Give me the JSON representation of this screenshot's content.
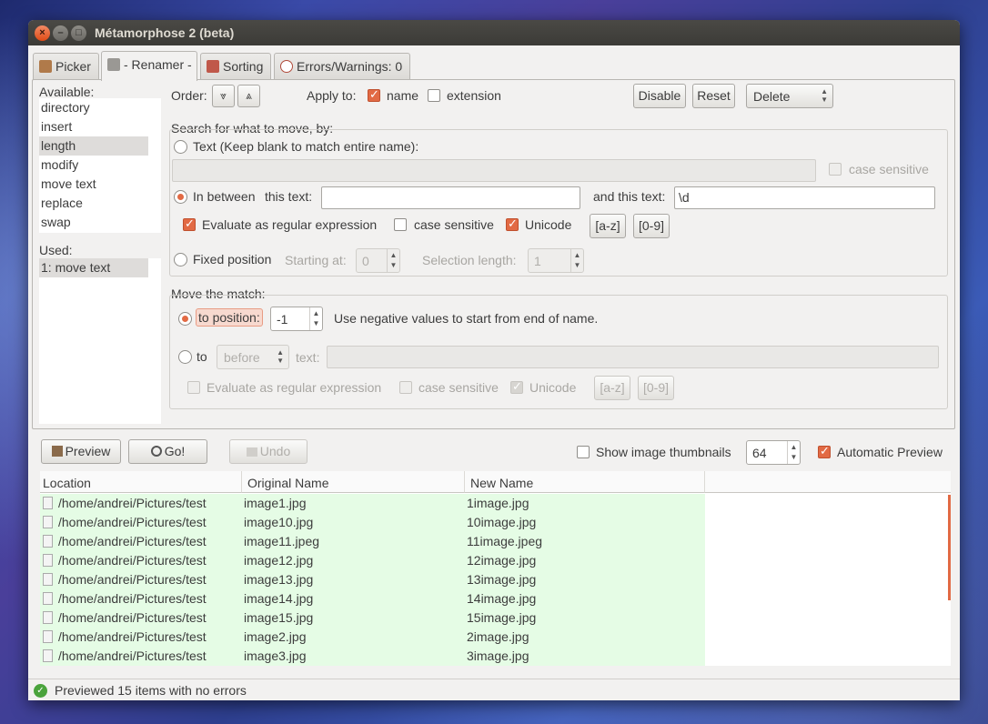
{
  "window": {
    "title": "Métamorphose 2 (beta)",
    "close": "×",
    "minimize": "–",
    "maximize": "□"
  },
  "tabs": [
    {
      "label": "Picker",
      "icon": "picker-icon"
    },
    {
      "label": "- Renamer -",
      "icon": "renamer-icon"
    },
    {
      "label": "Sorting",
      "icon": "sorting-icon"
    },
    {
      "label": "Errors/Warnings: 0",
      "icon": "error-icon"
    }
  ],
  "sidebar": {
    "available_label": "Available:",
    "available": [
      "directory",
      "insert",
      "length",
      "modify",
      "move text",
      "replace",
      "swap"
    ],
    "available_selected": "length",
    "used_label": "Used:",
    "used": [
      "1: move text"
    ]
  },
  "order": {
    "label": "Order:",
    "down": "⩔",
    "up": "⩓"
  },
  "apply_to": {
    "label": "Apply to:",
    "name": "name",
    "name_checked": true,
    "extension": "extension",
    "extension_checked": false
  },
  "actions": {
    "disable": "Disable",
    "reset": "Reset",
    "delete": "Delete"
  },
  "search": {
    "label": "Search for what to move, by:",
    "text_option": "Text (Keep blank to match entire name):",
    "text_value": "",
    "case_sensitive": "case sensitive",
    "between_option": "In between",
    "this_text_label": "this text:",
    "this_text_value": "",
    "and_this_text_label": "and this text:",
    "and_this_text_value": "\\d",
    "eval_regex": "Evaluate as regular expression",
    "case_sensitive2": "case sensitive",
    "unicode": "Unicode",
    "az": "[a-z]",
    "digits": "[0-9]",
    "fixed_option": "Fixed position",
    "starting_at_label": "Starting at:",
    "starting_at_value": "0",
    "sel_length_label": "Selection length:",
    "sel_length_value": "1"
  },
  "move": {
    "label": "Move the match:",
    "to_position": "to position:",
    "position_value": "-1",
    "hint": "Use negative values to start from end of name.",
    "to_label": "to",
    "before_option": "before",
    "text_label": "text:",
    "text_value": "",
    "eval_regex": "Evaluate as regular expression",
    "case_sensitive": "case sensitive",
    "unicode": "Unicode",
    "az": "[a-z]",
    "digits": "[0-9]"
  },
  "toolbar": {
    "preview": "Preview",
    "go": "Go!",
    "undo": "Undo",
    "show_thumbs": "Show image thumbnails",
    "thumb_size": "64",
    "auto_preview": "Automatic Preview"
  },
  "table": {
    "columns": [
      "Location",
      "Original Name",
      "New Name"
    ],
    "rows": [
      [
        "/home/andrei/Pictures/test",
        "image1.jpg",
        "1image.jpg"
      ],
      [
        "/home/andrei/Pictures/test",
        "image10.jpg",
        "10image.jpg"
      ],
      [
        "/home/andrei/Pictures/test",
        "image11.jpeg",
        "11image.jpeg"
      ],
      [
        "/home/andrei/Pictures/test",
        "image12.jpg",
        "12image.jpg"
      ],
      [
        "/home/andrei/Pictures/test",
        "image13.jpg",
        "13image.jpg"
      ],
      [
        "/home/andrei/Pictures/test",
        "image14.jpg",
        "14image.jpg"
      ],
      [
        "/home/andrei/Pictures/test",
        "image15.jpg",
        "15image.jpg"
      ],
      [
        "/home/andrei/Pictures/test",
        "image2.jpg",
        "2image.jpg"
      ],
      [
        "/home/andrei/Pictures/test",
        "image3.jpg",
        "3image.jpg"
      ]
    ]
  },
  "status": {
    "text": "Previewed 15 items with no errors",
    "icon": "check-circle-icon"
  },
  "colors": {
    "accent": "#e26a44",
    "row_ok": "#e5fce5",
    "titlebar": "#3c3b37"
  }
}
